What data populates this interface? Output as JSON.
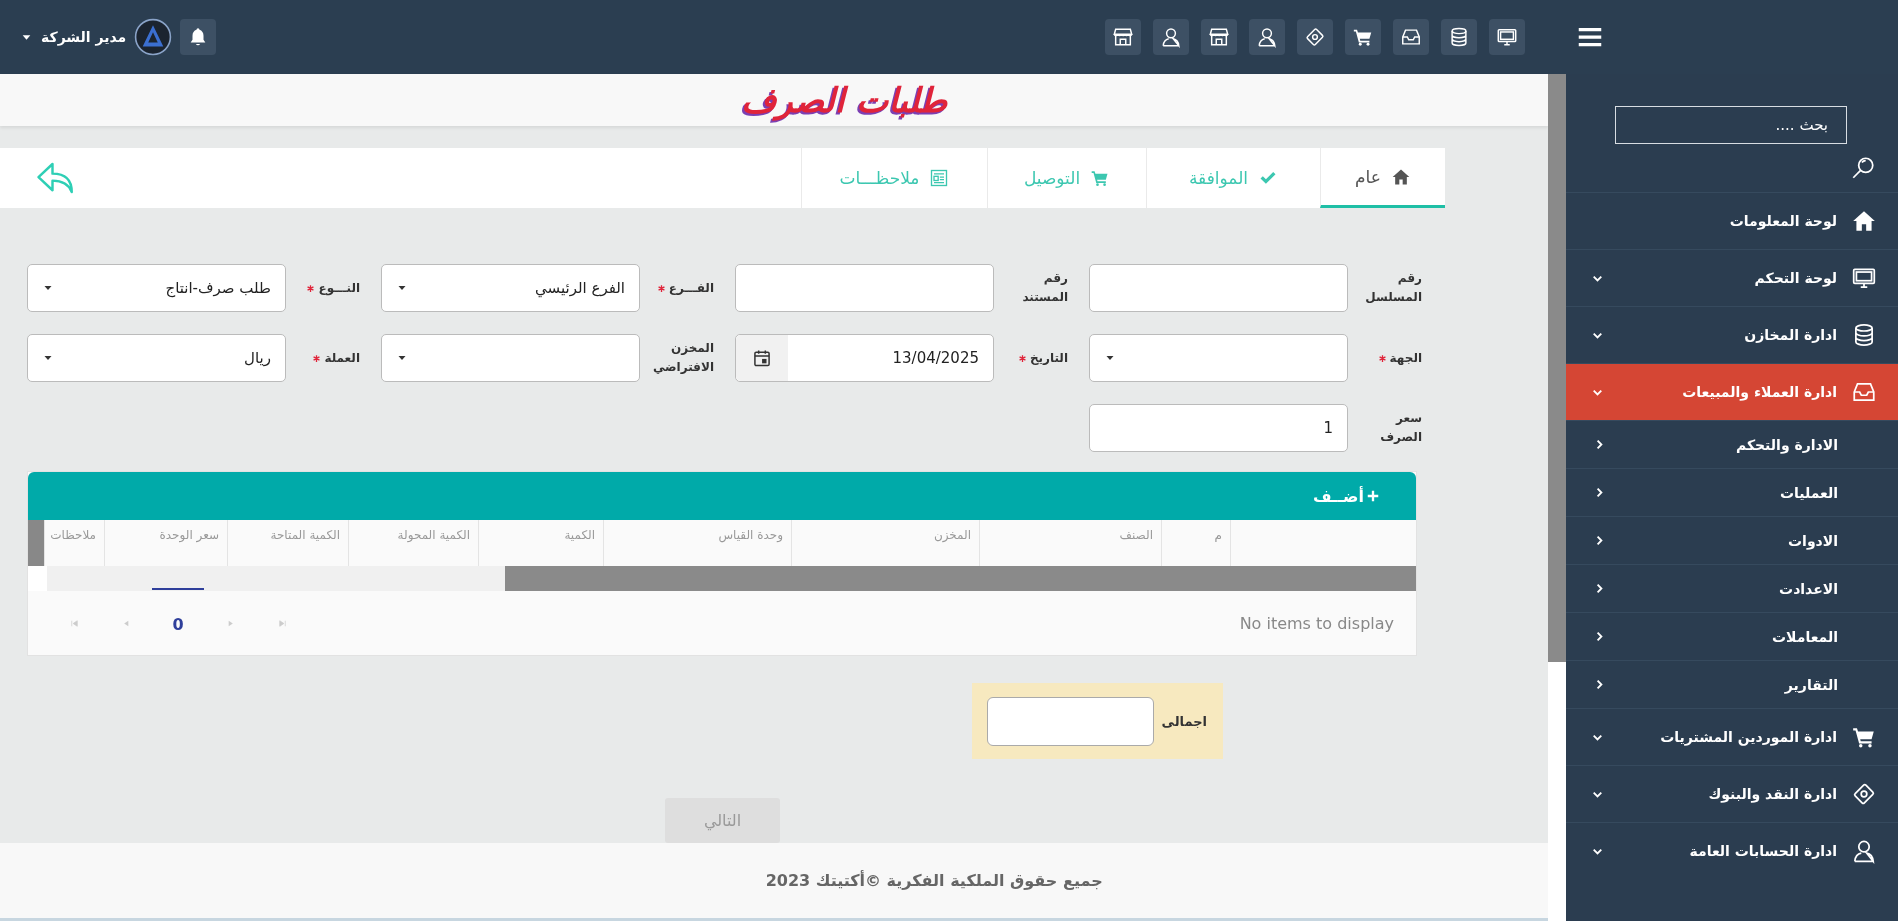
{
  "topbar": {
    "user_name": "مدير الشركة"
  },
  "page_title": "طلبات الصرف",
  "tabs": [
    {
      "label": "عام",
      "selected": true
    },
    {
      "label": "الموافقة",
      "selected": false
    },
    {
      "label": "التوصيل",
      "selected": false
    },
    {
      "label": "ملاحظـــات",
      "selected": false
    }
  ],
  "form": {
    "fields": [
      {
        "label": "رقم المسلسل",
        "kind": "text",
        "required": false
      },
      {
        "label": "رقم المستند",
        "kind": "text",
        "required": false
      },
      {
        "label": "الفـــرع",
        "kind": "select",
        "required": true,
        "value": "الفرع الرئيسي"
      },
      {
        "label": "النـــوع",
        "kind": "select",
        "required": true,
        "value": "طلب صرف-انتاج"
      },
      {
        "label": "الجهة",
        "kind": "select",
        "required": true
      },
      {
        "label": "التاريخ",
        "kind": "date",
        "required": true,
        "value": "13/04/2025"
      },
      {
        "label": "المخزن الافتراضي",
        "kind": "select",
        "required": false
      },
      {
        "label": "العملة",
        "kind": "select",
        "required": true,
        "value": "ريال"
      },
      {
        "label": "سعر الصرف",
        "kind": "text",
        "required": false,
        "value": "1"
      }
    ]
  },
  "grid": {
    "add_label": "أضــف",
    "columns": [
      "م",
      "الصنف",
      "المخزن",
      "وحدة القياس",
      "الكمية",
      "الكمية المحولة",
      "الكمية المتاحة",
      "سعر الوحدة",
      "ملاحظات"
    ],
    "page": "0",
    "empty_message": "No items to display"
  },
  "total": {
    "label": "اجمالى"
  },
  "next_button": {
    "label": "التالي",
    "disabled": true
  },
  "footer": "جميع حقوق الملكية الفكرية ©أكتيتك 2023",
  "sidebar": {
    "search_placeholder": "بحث ....",
    "items": [
      {
        "label": "لوحة المعلومات",
        "selected": false,
        "expandable": false
      },
      {
        "label": "لوحة التحكم",
        "selected": false,
        "expandable": true
      },
      {
        "label": "ادارة المخازن",
        "selected": false,
        "expandable": true
      },
      {
        "label": "ادارة العملاء والمبيعات",
        "selected": true,
        "expandable": true,
        "children": [
          {
            "label": "الادارة والتحكم"
          },
          {
            "label": "العمليات"
          },
          {
            "label": "الادوات"
          },
          {
            "label": "الاعدادت"
          },
          {
            "label": "المعاملات"
          },
          {
            "label": "التقارير"
          }
        ]
      },
      {
        "label": "ادارة الموردين المشتريات",
        "selected": false,
        "expandable": true
      },
      {
        "label": "ادارة النقد والبنوك",
        "selected": false,
        "expandable": true
      },
      {
        "label": "ادارة الحسابات العامة",
        "selected": false,
        "expandable": true
      }
    ]
  }
}
